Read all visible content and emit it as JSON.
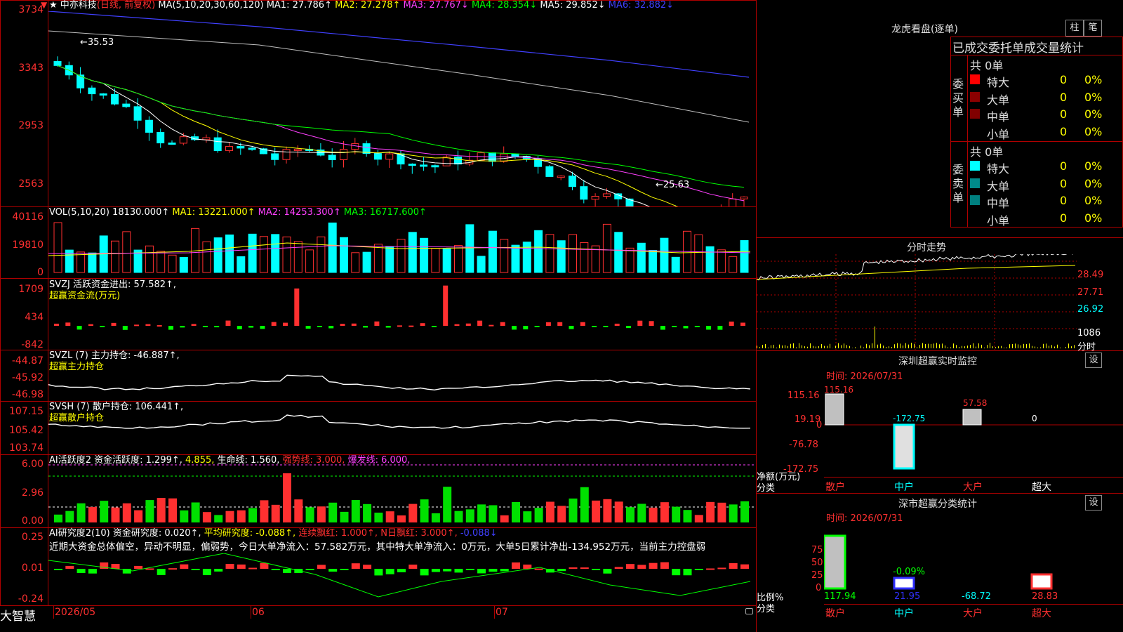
{
  "header": {
    "star": "★",
    "stock_name": "中亦科技",
    "period": "(日线, 前复权)",
    "ma_label": "MA(5,10,20,30,60,120)",
    "ma1": "MA1: 27.786↑",
    "ma2": "MA2: 27.278↑",
    "ma3": "MA3: 27.767↓",
    "ma4": "MA4: 28.354↓",
    "ma5": "MA5: 29.852↓",
    "ma6": "MA6: 32.882↓"
  },
  "price_axis": [
    "3734",
    "3343",
    "2953",
    "2563"
  ],
  "price_annotations": {
    "high": "←35.53",
    "low": "←25.63"
  },
  "vol": {
    "label": "VOL(5,10,20)",
    "value": "18130.000↑",
    "ma1": "MA1: 13221.000↑",
    "ma2": "MA2: 14253.300↑",
    "ma3": "MA3: 16717.600↑",
    "axis": [
      "40116",
      "19810",
      "0"
    ]
  },
  "svzj": {
    "label": "SVZJ  活跃资金进出: 57.582↑,",
    "sub": "超赢资金流(万元)",
    "axis": [
      "1709",
      "434",
      "-842"
    ]
  },
  "svzl": {
    "label": "SVZL (7) 主力持仓: -46.887↑,",
    "sub": "超赢主力持仓",
    "axis": [
      "-44.87",
      "-45.92",
      "-46.98"
    ]
  },
  "svsh": {
    "label": "SVSH (7) 散户持仓: 106.441↑,",
    "sub": "超赢散户持仓",
    "axis": [
      "107.15",
      "105.42",
      "103.74"
    ]
  },
  "ai_active": {
    "label": "AI活跃度2 资金活跃度: 1.299↑,",
    "v2": "4.855,",
    "life": "生命线: 1.560,",
    "strong": "强势线: 3.000,",
    "burst": "爆发线: 6.000,",
    "axis": [
      "6.00",
      "2.96",
      "0.00"
    ]
  },
  "ai_research": {
    "label": "AI研究度2(10) 资金研究度: 0.020↑,",
    "avg": "平均研究度: -0.088↑,",
    "streak": "连续飘红: 1.000↑,",
    "ndays": "N日飘红: 3.000↑,",
    "last": "-0.088↓",
    "commentary": "近期大资金总体偏空，异动不明显，偏弱势，今日大单净流入：57.582万元，其中特大单净流入：0万元，大单5日累计净出-134.952万元，当前主力控盘弱",
    "axis": [
      "0.25",
      "0.01",
      "-0.24"
    ]
  },
  "bottom_axis": {
    "brand": "大智慧",
    "dates": [
      "2026/05",
      "06",
      "07"
    ]
  },
  "right_panel": {
    "dragon_title": "龙虎看盘(逐单)",
    "btn_bar": "柱",
    "btn_pen": "笔",
    "stats_title": "已成交委托单成交量统计",
    "buy_side": "委买单",
    "sell_side": "委卖单",
    "buy_total": "共 0单",
    "sell_total": "共 0单",
    "rows": [
      {
        "label": "特大",
        "val": "0",
        "pct": "0%"
      },
      {
        "label": "大单",
        "val": "0",
        "pct": "0%"
      },
      {
        "label": "中单",
        "val": "0",
        "pct": "0%"
      },
      {
        "label": "小单",
        "val": "0",
        "pct": "0%"
      }
    ],
    "intraday_title": "分时走势",
    "intraday_axis": [
      "28.49",
      "27.71",
      "26.92",
      "1086",
      "分时"
    ],
    "sz_monitor_title": "深圳超赢实时监控",
    "sz_monitor_btn": "设",
    "sz_time": "时间: 2026/07/31",
    "sz_axis": [
      "115.16",
      "19.19",
      "0",
      "-76.78",
      "-172.75"
    ],
    "sz_values": {
      "retail": "115.16",
      "mid": "-172.75",
      "big": "57.58",
      "super": "0"
    },
    "sz_net_label": "净额(万元)",
    "sz_class_label": "分类",
    "categories": [
      "散户",
      "中户",
      "大户",
      "超大"
    ],
    "cls_title": "深市超赢分类统计",
    "cls_btn": "设",
    "cls_time": "时间: 2026/07/31",
    "cls_axis": [
      "75",
      "50",
      "25",
      "0"
    ],
    "cls_values": {
      "retail": "117.94",
      "mid": "21.95",
      "big": "-68.72",
      "super": "28.83",
      "mid_pct": "-0.09%"
    },
    "cls_ratio_label": "比例%",
    "cls_class_label": "分类"
  },
  "colors": {
    "up": "#ff3030",
    "down": "#00ffff",
    "grid": "#b00000",
    "ma1": "#ffffff",
    "ma2": "#ffff00",
    "ma3": "#ff40ff",
    "ma4": "#00ff00",
    "ma5": "#c0c0c0",
    "ma6": "#4040ff"
  }
}
